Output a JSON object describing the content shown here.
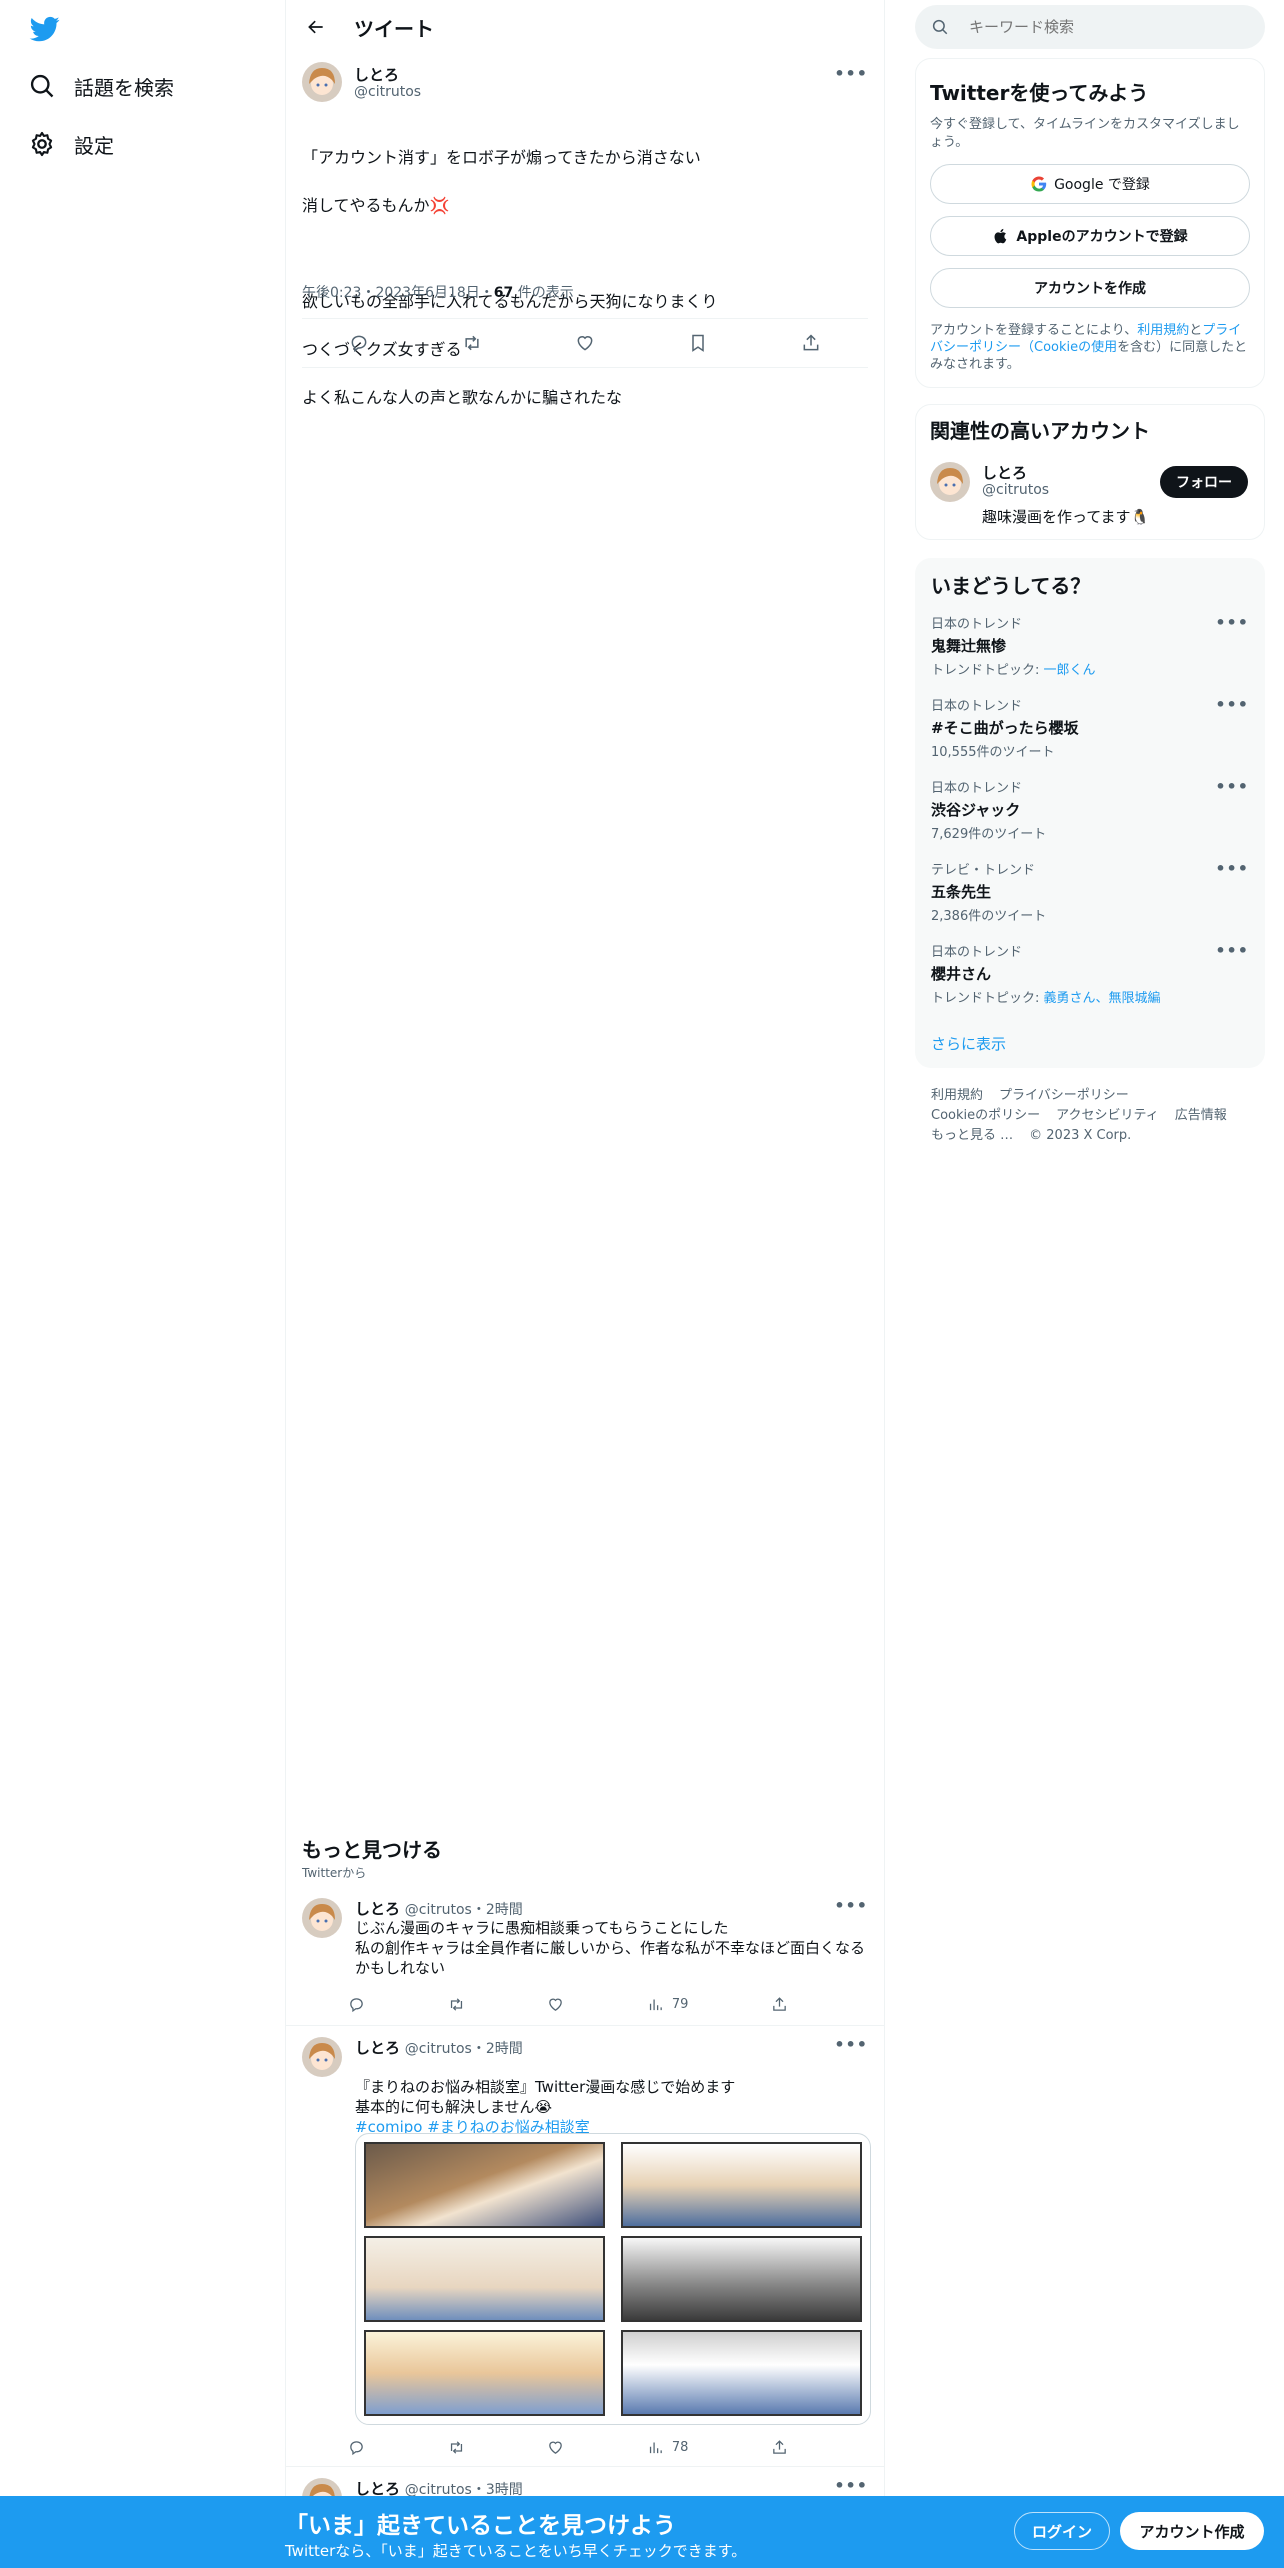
{
  "nav": {
    "logo_icon": "twitter-bird-icon",
    "explore_label": "話題を検索",
    "settings_label": "設定"
  },
  "header": {
    "title": "ツイート"
  },
  "tweet": {
    "name": "しとろ",
    "handle": "@citrutos",
    "body_line1": "「アカウント消す」をロボ子が煽ってきたから消さない",
    "body_line2": "消してやるもんか💢",
    "body_line3": "欲しいもの全部手に入れてるもんだから天狗になりまくり",
    "body_line4": "つくづくクズ女すぎる",
    "body_line5": "よく私こんな人の声と歌なんかに騙されたな",
    "time": "午後0:23・2023年6月18日・",
    "views_count": "67",
    "views_label": " 件の表示"
  },
  "discover": {
    "title": "もっと見つける",
    "subtitle": "Twitterから"
  },
  "feed": [
    {
      "name": "しとろ",
      "handle": "@citrutos",
      "time": "・2時間",
      "text": "じぶん漫画のキャラに愚痴相談乗ってもらうことにした\n私の創作キャラは全員作者に厳しいから、作者な私が不幸なほど面白くなる\nかもしれない",
      "views": "79"
    },
    {
      "name": "しとろ",
      "handle": "@citrutos",
      "time": "・2時間",
      "text": "『まりねのお悩み相談室』Twitter漫画な感じで始めます\n基本的に何も解決しません😭",
      "tags": "#comipo #まりねのお悩み相談室",
      "views": "78"
    },
    {
      "name": "しとろ",
      "handle": "@citrutos",
      "time": "・3時間"
    }
  ],
  "search": {
    "placeholder": "キーワード検索"
  },
  "signup_card": {
    "title": "Twitterを使ってみよう",
    "desc": "今すぐ登録して、タイムラインをカスタマイズしましょう。",
    "google_label": "Google で登録",
    "apple_label": "Appleのアカウントで登録",
    "create_label": "アカウントを作成",
    "terms_pre": "アカウントを登録することにより、",
    "terms_link1": "利用規約",
    "terms_mid": "と",
    "terms_link2": "プライバシーポリシー（Cookieの使用",
    "terms_post": "を含む）に同意したとみなされます。"
  },
  "related": {
    "title": "関連性の高いアカウント",
    "name": "しとろ",
    "handle": "@citrutos",
    "bio": "趣味漫画を作ってます🐧",
    "follow_label": "フォロー"
  },
  "trends": {
    "title": "いまどうしてる？",
    "items": [
      {
        "context": "日本のトレンド",
        "topic": "鬼舞辻無惨",
        "meta_pre": "トレンドトピック: ",
        "meta_link": "一郎くん"
      },
      {
        "context": "日本のトレンド",
        "topic": "#そこ曲がったら櫻坂",
        "meta_pre": "10,555件のツイート",
        "meta_link": ""
      },
      {
        "context": "日本のトレンド",
        "topic": "渋谷ジャック",
        "meta_pre": "7,629件のツイート",
        "meta_link": ""
      },
      {
        "context": "テレビ・トレンド",
        "topic": "五条先生",
        "meta_pre": "2,386件のツイート",
        "meta_link": ""
      },
      {
        "context": "日本のトレンド",
        "topic": "櫻井さん",
        "meta_pre": "トレンドトピック: ",
        "meta_link": "義勇さん、無限城編"
      }
    ],
    "show_more": "さらに表示"
  },
  "footer": {
    "terms": "利用規約",
    "privacy": "プライバシーポリシー",
    "cookie": "Cookieのポリシー",
    "accessibility": "アクセシビリティ",
    "ads": "広告情報",
    "more": "もっと見る …",
    "copyright": "© 2023 X Corp."
  },
  "banner": {
    "title": "「いま」起きていることを見つけよう",
    "subtitle": "Twitterなら、「いま」起きていることをいち早くチェックできます。",
    "login_label": "ログイン",
    "signup_label": "アカウント作成"
  },
  "colors": {
    "brand": "#1d9bf0",
    "text": "#0f1419",
    "secondary": "#536471",
    "border": "#eff3f4"
  }
}
